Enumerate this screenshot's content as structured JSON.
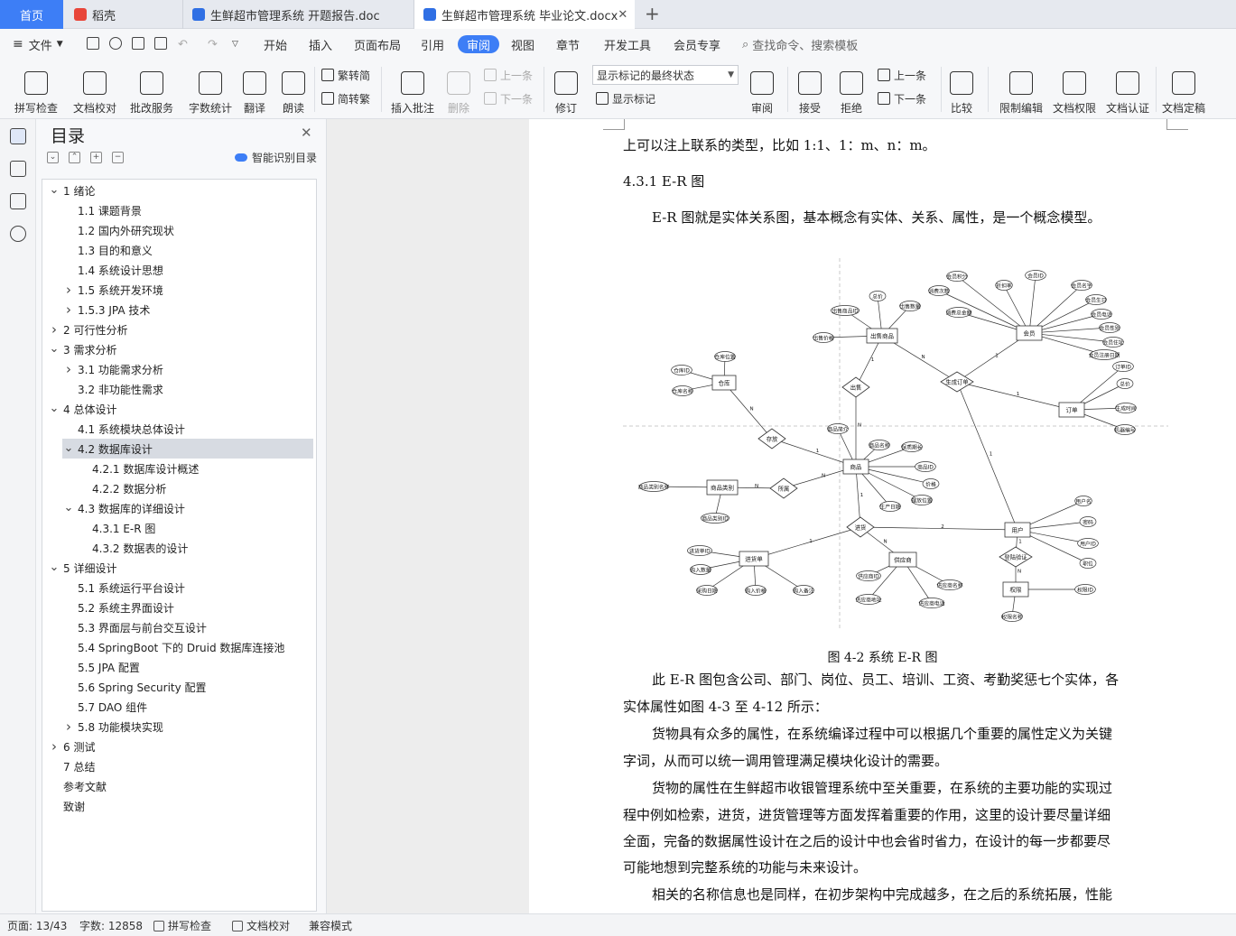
{
  "tabs": {
    "home": "首页",
    "t1": "稻壳",
    "t2": "生鲜超市管理系统 开题报告.doc",
    "t3": "生鲜超市管理系统 毕业论文.docx",
    "close": "✕",
    "new": "+"
  },
  "menu": {
    "file": "文件",
    "items": [
      "开始",
      "插入",
      "页面布局",
      "引用",
      "审阅",
      "视图",
      "章节",
      "开发工具",
      "会员专享"
    ],
    "active_index": 4,
    "search": "查找命令、搜索模板"
  },
  "ribbon": {
    "spell": "拼写检查",
    "proof": "文档校对",
    "annotate_service": "批改服务",
    "wordcount": "字数统计",
    "translate": "翻译",
    "read": "朗读",
    "trad": "繁转简",
    "simp": "简转繁",
    "insert_comment": "插入批注",
    "delete": "删除",
    "prev": "上一条",
    "next": "下一条",
    "track": "修订",
    "markup_select": "显示标记的最终状态",
    "show_markup": "显示标记",
    "review": "审阅",
    "accept": "接受",
    "reject": "拒绝",
    "prev2": "上一条",
    "next2": "下一条",
    "compare": "比较",
    "restrict": "限制编辑",
    "perm": "文档权限",
    "cert": "文档认证",
    "final": "文档定稿"
  },
  "nav": {
    "title": "目录",
    "ai": "智能识别目录",
    "items": [
      {
        "t": "1 绪论",
        "lv": 0,
        "c": "v"
      },
      {
        "t": "1.1 课题背景",
        "lv": 1,
        "c": ""
      },
      {
        "t": "1.2  国内外研究现状",
        "lv": 1,
        "c": ""
      },
      {
        "t": "1.3  目的和意义",
        "lv": 1,
        "c": ""
      },
      {
        "t": "1.4  系统设计思想",
        "lv": 1,
        "c": ""
      },
      {
        "t": "1.5  系统开发环境",
        "lv": 1,
        "c": ">"
      },
      {
        "t": "1.5.3    JPA 技术",
        "lv": 1,
        "c": ">"
      },
      {
        "t": "2 可行性分析",
        "lv": 0,
        "c": ">"
      },
      {
        "t": "3 需求分析",
        "lv": 0,
        "c": "v"
      },
      {
        "t": "3.1  功能需求分析",
        "lv": 1,
        "c": ">"
      },
      {
        "t": "3.2  非功能性需求",
        "lv": 1,
        "c": ""
      },
      {
        "t": "4 总体设计",
        "lv": 0,
        "c": "v"
      },
      {
        "t": "4.1  系统模块总体设计",
        "lv": 1,
        "c": ""
      },
      {
        "t": "4.2  数据库设计",
        "lv": 1,
        "c": "v",
        "sel": true
      },
      {
        "t": "4.2.1  数据库设计概述",
        "lv": 2,
        "c": ""
      },
      {
        "t": "4.2.2  数据分析",
        "lv": 2,
        "c": ""
      },
      {
        "t": "4.3 数据库的详细设计",
        "lv": 1,
        "c": "v"
      },
      {
        "t": "4.3.1 E-R 图",
        "lv": 2,
        "c": ""
      },
      {
        "t": "4.3.2  数据表的设计",
        "lv": 2,
        "c": ""
      },
      {
        "t": "5 详细设计",
        "lv": 0,
        "c": "v"
      },
      {
        "t": "5.1  系统运行平台设计",
        "lv": 1,
        "c": ""
      },
      {
        "t": "5.2  系统主界面设计",
        "lv": 1,
        "c": ""
      },
      {
        "t": "5.3  界面层与前台交互设计",
        "lv": 1,
        "c": ""
      },
      {
        "t": "5.4 SpringBoot 下的 Druid 数据库连接池",
        "lv": 1,
        "c": ""
      },
      {
        "t": "5.5 JPA 配置",
        "lv": 1,
        "c": ""
      },
      {
        "t": "5.6 Spring Security 配置",
        "lv": 1,
        "c": ""
      },
      {
        "t": "5.7 DAO 组件",
        "lv": 1,
        "c": ""
      },
      {
        "t": "5.8  功能模块实现",
        "lv": 1,
        "c": ">"
      },
      {
        "t": "6 测试",
        "lv": 0,
        "c": ">"
      },
      {
        "t": "7 总结",
        "lv": 0,
        "c": ""
      },
      {
        "t": "参考文献",
        "lv": 0,
        "c": ""
      },
      {
        "t": "致谢",
        "lv": 0,
        "c": ""
      }
    ]
  },
  "doc": {
    "lines": [
      "上可以注上联系的类型，比如 1:1、1：m、n：m。",
      "4.3.1 E-R 图",
      "    E-R 图就是实体关系图，基本概念有实体、关系、属性，是一个概念模型。",
      "    此 E-R 图包含公司、部门、岗位、员工、培训、工资、考勤奖惩七个实体，各",
      "实体属性如图 4-3 至 4-12 所示：",
      "    货物具有众多的属性，在系统编译过程中可以根据几个重要的属性定义为关键",
      "字词，从而可以统一调用管理满足模块化设计的需要。",
      "    货物的属性在生鲜超市收银管理系统中至关重要，在系统的主要功能的实现过",
      "程中例如检索，进货，进货管理等方面发挥着重要的作用，这里的设计要尽量详细",
      "全面，完备的数据属性设计在之后的设计中也会省时省力，在设计的每一步都要尽",
      "可能地想到完整系统的功能与未来设计。",
      "    相关的名称信息也是同样，在初步架构中完成越多，在之后的系统拓展，性能"
    ],
    "caption": "图 4-2      系统 E-R 图"
  },
  "er": {
    "entities": [
      {
        "id": "outgoods",
        "label": "出售商品"
      },
      {
        "id": "member",
        "label": "会员"
      },
      {
        "id": "warehouse",
        "label": "仓库"
      },
      {
        "id": "order",
        "label": "订单"
      },
      {
        "id": "goods",
        "label": "商品"
      },
      {
        "id": "category",
        "label": "商品类别"
      },
      {
        "id": "purchase",
        "label": "进货单"
      },
      {
        "id": "supplier",
        "label": "供应商"
      },
      {
        "id": "user",
        "label": "用户"
      },
      {
        "id": "permission",
        "label": "权限"
      }
    ],
    "relations": [
      {
        "id": "r_sell",
        "label": "出售"
      },
      {
        "id": "r_order",
        "label": "生成订单"
      },
      {
        "id": "r_store",
        "label": "存放"
      },
      {
        "id": "r_belong",
        "label": "所属"
      },
      {
        "id": "r_stock",
        "label": "进货"
      },
      {
        "id": "r_login",
        "label": "登陆验证"
      }
    ],
    "attributes": [
      {
        "of": "outgoods",
        "label": "总价"
      },
      {
        "of": "outgoods",
        "label": "出售商品ID"
      },
      {
        "of": "outgoods",
        "label": "出售数量"
      },
      {
        "of": "outgoods",
        "label": "出售价格"
      },
      {
        "of": "member",
        "label": "会员积分"
      },
      {
        "of": "member",
        "label": "折扣率"
      },
      {
        "of": "member",
        "label": "会员ID"
      },
      {
        "of": "member",
        "label": "消费次数"
      },
      {
        "of": "member",
        "label": "会员名字"
      },
      {
        "of": "member",
        "label": "会员生日"
      },
      {
        "of": "member",
        "label": "消费总金额"
      },
      {
        "of": "member",
        "label": "会员电话"
      },
      {
        "of": "member",
        "label": "会员性别"
      },
      {
        "of": "member",
        "label": "会员住址"
      },
      {
        "of": "member",
        "label": "会员注册日期"
      },
      {
        "of": "warehouse",
        "label": "仓库位置"
      },
      {
        "of": "warehouse",
        "label": "仓库ID"
      },
      {
        "of": "warehouse",
        "label": "仓库名称"
      },
      {
        "of": "order",
        "label": "订单ID"
      },
      {
        "of": "order",
        "label": "总价"
      },
      {
        "of": "order",
        "label": "生成时间"
      },
      {
        "of": "order",
        "label": "机器编号"
      },
      {
        "of": "goods",
        "label": "商品简介"
      },
      {
        "of": "goods",
        "label": "商品名称"
      },
      {
        "of": "goods",
        "label": "保质期长"
      },
      {
        "of": "goods",
        "label": "商品ID"
      },
      {
        "of": "goods",
        "label": "价格"
      },
      {
        "of": "goods",
        "label": "摆放位置"
      },
      {
        "of": "goods",
        "label": "生产日期"
      },
      {
        "of": "category",
        "label": "商品类别名称"
      },
      {
        "of": "category",
        "label": "商品类别ID"
      },
      {
        "of": "purchase",
        "label": "进货单ID"
      },
      {
        "of": "purchase",
        "label": "购入数量"
      },
      {
        "of": "purchase",
        "label": "采购日期"
      },
      {
        "of": "purchase",
        "label": "购入价格"
      },
      {
        "of": "purchase",
        "label": "购入备注"
      },
      {
        "of": "supplier",
        "label": "供应商ID"
      },
      {
        "of": "supplier",
        "label": "供应商名称"
      },
      {
        "of": "supplier",
        "label": "供应商地址"
      },
      {
        "of": "supplier",
        "label": "供应商电话"
      },
      {
        "of": "user",
        "label": "用户名"
      },
      {
        "of": "user",
        "label": "密码"
      },
      {
        "of": "user",
        "label": "用户ID"
      },
      {
        "of": "user",
        "label": "职位"
      },
      {
        "of": "permission",
        "label": "权限ID"
      },
      {
        "of": "permission",
        "label": "权限名称"
      }
    ],
    "cardinality": [
      "1",
      "N",
      "N",
      "1",
      "1",
      "N",
      "1",
      "N",
      "N",
      "1",
      "1",
      "N",
      "2",
      "1",
      "1",
      "N"
    ]
  },
  "status": {
    "page": "页面: 13/43",
    "words": "字数: 12858",
    "spell": "拼写检查",
    "proof": "文档校对",
    "compat": "兼容模式"
  }
}
